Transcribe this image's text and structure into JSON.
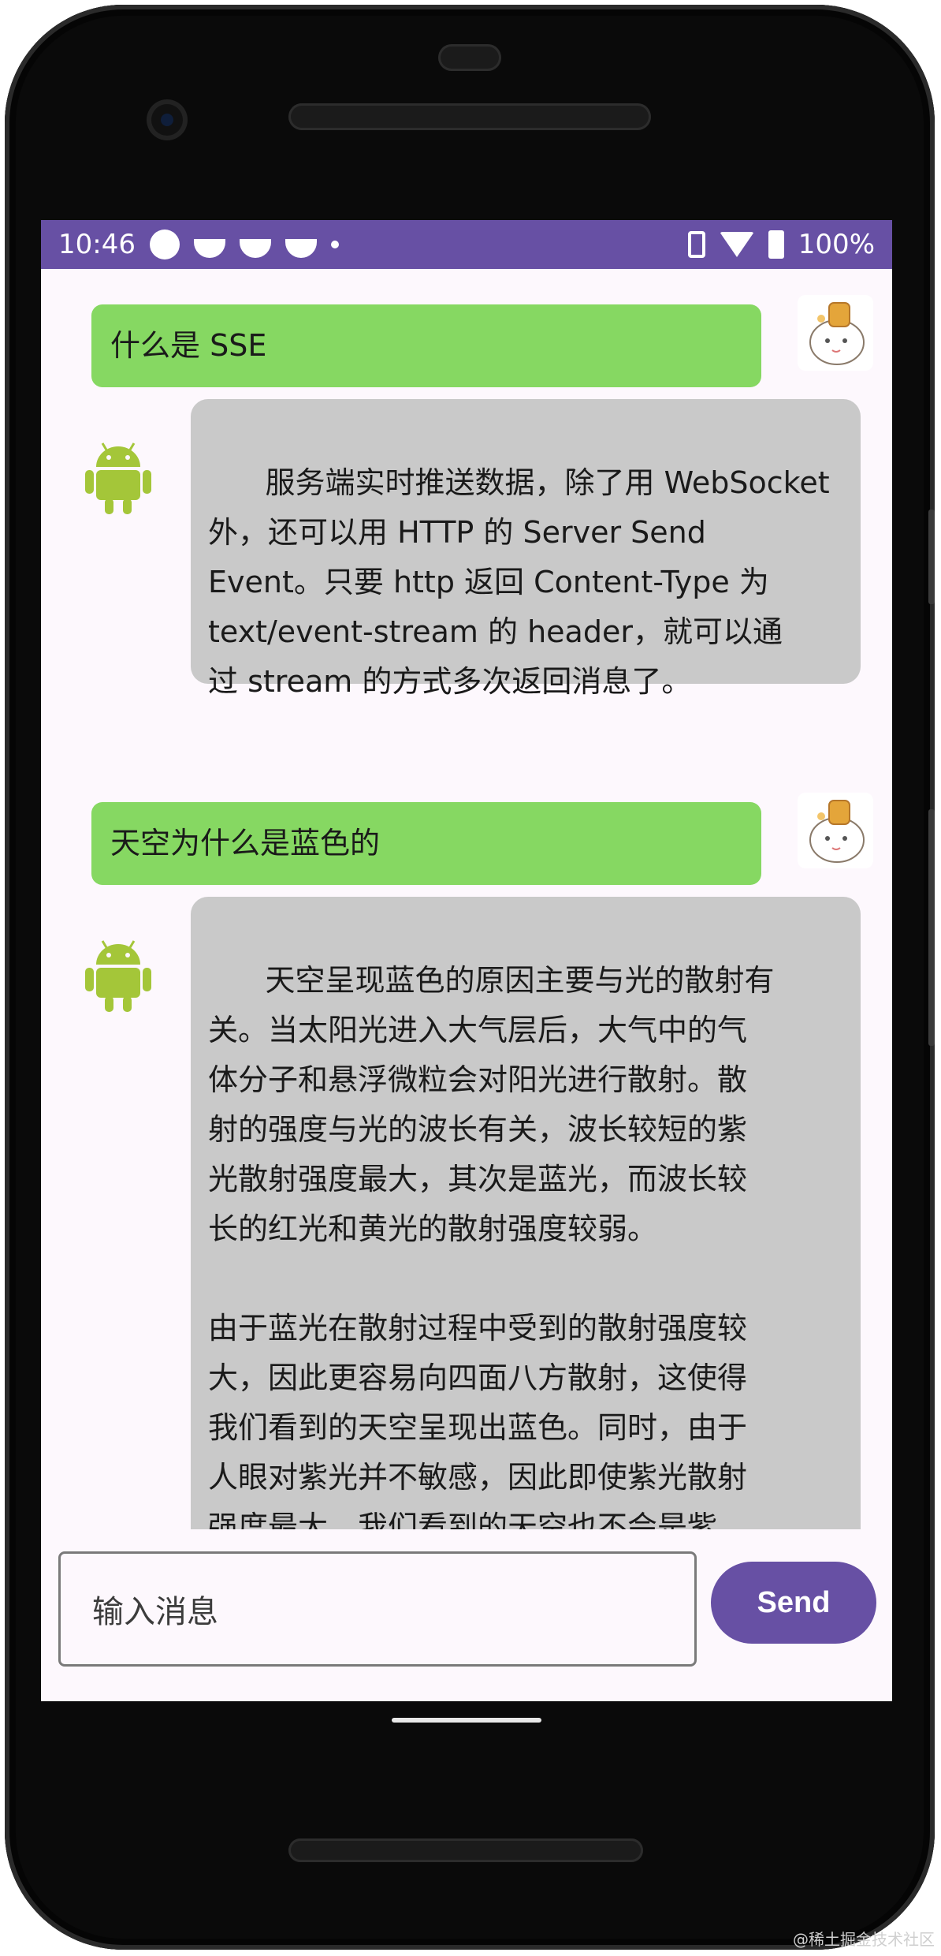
{
  "status_bar": {
    "time": "10:46",
    "battery": "100%",
    "icons_left": [
      "app-icon",
      "notification-bowl-icon",
      "notification-bowl-icon",
      "notification-bowl-icon",
      "more-dot-icon"
    ],
    "icons_right": [
      "vibrate-icon",
      "wifi-icon",
      "battery-charging-icon"
    ],
    "color": "#6750a4"
  },
  "messages": [
    {
      "role": "user",
      "text": "什么是 SSE"
    },
    {
      "role": "bot",
      "text": "服务端实时推送数据，除了用 WebSocket\n外，还可以用 HTTP 的 Server Send\nEvent。只要 http 返回 Content-Type 为\ntext/event-stream 的 header，就可以通\n过 stream 的方式多次返回消息了。"
    },
    {
      "role": "user",
      "text": "天空为什么是蓝色的"
    },
    {
      "role": "bot",
      "text": "天空呈现蓝色的原因主要与光的散射有\n关。当太阳光进入大气层后，大气中的气\n体分子和悬浮微粒会对阳光进行散射。散\n射的强度与光的波长有关，波长较短的紫\n光散射强度最大，其次是蓝光，而波长较\n长的红光和黄光的散射强度较弱。\n\n由于蓝光在散射过程中受到的散射强度较\n大，因此更容易向四面八方散射，这使得\n我们看到的天空呈现出蓝色。同时，由于\n人眼对紫光并不敏感，因此即使紫光散射\n强度最大，我们看到的天空也不会是紫"
    }
  ],
  "input": {
    "placeholder": "输入消息"
  },
  "send_button": {
    "label": "Send"
  },
  "colors": {
    "user_bubble": "#86d862",
    "bot_bubble": "#c9c9c9",
    "accent": "#6750a4"
  },
  "watermark": "@稀土掘金技术社区"
}
